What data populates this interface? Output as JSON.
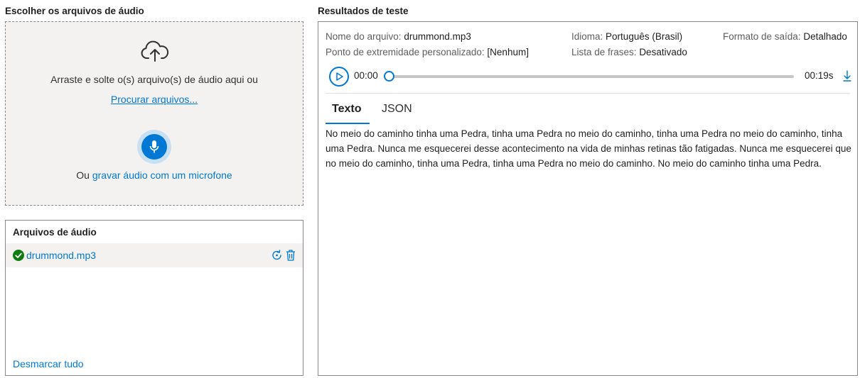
{
  "upload": {
    "title": "Escolher os arquivos de áudio",
    "drop_text": "Arraste e solte o(s) arquivo(s) de áudio aqui ou",
    "browse_label": "Procurar arquivos...",
    "mic_prefix": "Ou ",
    "mic_link": "gravar áudio com um microfone",
    "icons": {
      "upload": "cloud-upload-icon",
      "mic": "microphone-icon"
    }
  },
  "files": {
    "title": "Arquivos de áudio",
    "items": [
      {
        "name": "drummond.mp3",
        "status": "success",
        "icons": [
          "check-circle-icon",
          "retry-icon",
          "trash-icon"
        ]
      }
    ],
    "deselect_label": "Desmarcar tudo"
  },
  "results": {
    "title": "Resultados de teste",
    "meta": {
      "file_label": "Nome do arquivo:",
      "file_value": "drummond.mp3",
      "lang_label": "Idioma:",
      "lang_value": "Português (Brasil)",
      "format_label": "Formato de saída:",
      "format_value": "Detalhado",
      "endpoint_label": "Ponto de extremidade personalizado:",
      "endpoint_value": "[Nenhum]",
      "phrases_label": "Lista de frases:",
      "phrases_value": "Desativado"
    },
    "player": {
      "time_start": "00:00",
      "time_end": "00:19s",
      "progress": 0
    },
    "tabs": [
      {
        "label": "Texto",
        "active": true
      },
      {
        "label": "JSON",
        "active": false
      }
    ],
    "transcript": "No meio do caminho tinha uma Pedra, tinha uma Pedra no meio do caminho, tinha uma Pedra no meio do caminho, tinha uma Pedra. Nunca me esquecerei desse acontecimento na vida de minhas retinas tão fatigadas. Nunca me esquecerei que no meio do caminho, tinha uma Pedra, tinha uma Pedra no meio do caminho. No meio do caminho tinha uma Pedra."
  },
  "colors": {
    "accent": "#0078d4",
    "success": "#107c10",
    "panel_bg": "#f3f2f1",
    "border": "#8a8886"
  }
}
